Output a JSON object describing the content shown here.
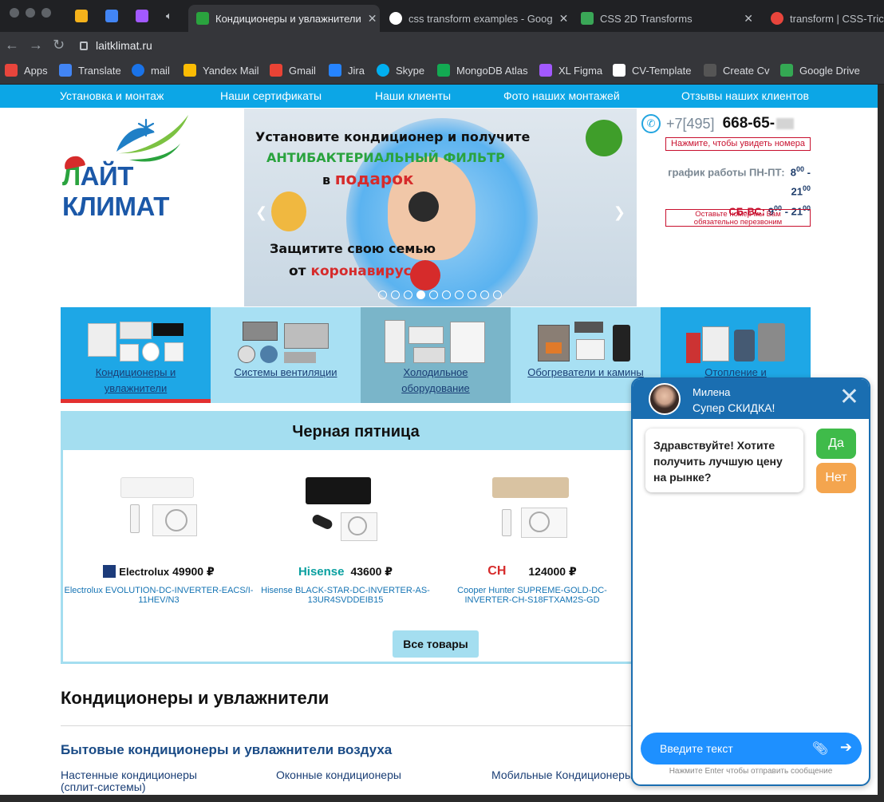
{
  "browser": {
    "tabs": [
      {
        "title": "Кондиционеры и увлажнители",
        "active": true
      },
      {
        "title": "css transform examples - Goog",
        "active": false
      },
      {
        "title": "CSS 2D Transforms",
        "active": false
      },
      {
        "title": "transform | CSS-Tricks",
        "active": false
      }
    ],
    "url": "laitklimat.ru",
    "bookmarks": [
      "Apps",
      "Translate",
      "mail",
      "Yandex Mail",
      "Gmail",
      "Jira",
      "Skype",
      "MongoDB Atlas",
      "XL Figma",
      "CV-Template",
      "Create Cv",
      "Google Drive"
    ]
  },
  "topnav": [
    "Установка и монтаж",
    "Наши сертификаты",
    "Наши клиенты",
    "Фото наших монтажей",
    "Отзывы наших клиентов"
  ],
  "logo": {
    "text_a": "Л",
    "text_b": "АЙТ КЛИМАТ"
  },
  "banner": {
    "line1": "Установите кондиционер и получите",
    "line2": "АНТИБАКТЕРИАЛЬНЫЙ ФИЛЬТР",
    "line3a": "в ",
    "line3b": "подарок",
    "line4": "Защитите свою семью",
    "line5a": "от ",
    "line5b": "коронавируса",
    "active_slide": 4,
    "slide_count": 10
  },
  "contacts": {
    "phone_prefix": "+7[495]",
    "phone_number": "668-65-",
    "show_numbers": "Нажмите, чтобы увидеть номера",
    "hours_label": "график работы ПН-ПТ:",
    "weekday_from": "8",
    "weekday_to": "21",
    "sup": "00",
    "weekend_label": "СБ-ВС:",
    "weekend_from": "9",
    "weekend_to": "21",
    "callback": "Оставьте номер мы Вам обязательно перезвоним"
  },
  "categories": [
    {
      "label": "Кондиционеры и увлажнители",
      "bg": "#1ea7e6",
      "active": true
    },
    {
      "label": "Системы вентиляции",
      "bg": "#a8e0f3",
      "active": false
    },
    {
      "label": "Холодильное оборудование",
      "bg": "#7ab5c9",
      "active": false
    },
    {
      "label": "Обогреватели и камины",
      "bg": "#a8e0f3",
      "active": false
    },
    {
      "label": "Отопление и",
      "bg": "#1ea7e6",
      "active": false
    }
  ],
  "black_friday": {
    "title": "Черная пятница",
    "products": [
      {
        "brand": "Electrolux",
        "price": "49900 ₽",
        "name": "Electrolux EVOLUTION-DC-INVERTER-EACS/I-11HEV/N3",
        "unit_color": "#f4f4f4"
      },
      {
        "brand": "Hisense",
        "price": "43600 ₽",
        "name": "Hisense BLACK-STAR-DC-INVERTER-AS-13UR4SVDDEIB15",
        "unit_color": "#151515"
      },
      {
        "brand": "CH",
        "price": "124000 ₽",
        "name": "Cooper Hunter SUPREME-GOLD-DC-INVERTER-CH-S18FTXAM2S-GD",
        "unit_color": "#d9c3a2"
      }
    ],
    "all_button": "Все товары"
  },
  "section": {
    "title": "Кондиционеры и увлажнители",
    "subtitle": "Бытовые кондиционеры и увлажнители воздуха",
    "links": [
      "Настенные кондиционеры (сплит-системы)",
      "Оконные кондиционеры",
      "Мобильные Кондиционеры"
    ]
  },
  "chat": {
    "agent": "Милена",
    "promo": "Супер СКИДКА!",
    "message": "Здравствуйте! Хотите получить лучшую цену на рынке?",
    "yes": "Да",
    "no": "Нет",
    "input_placeholder": "Введите текст",
    "hint": "Нажмите Enter чтобы отправить сообщение"
  },
  "colors": {
    "nav": "#0ca6e6",
    "chat_header": "#1a6eb1",
    "accent_red": "#c8102e",
    "brand_blue": "#1b58a8"
  }
}
